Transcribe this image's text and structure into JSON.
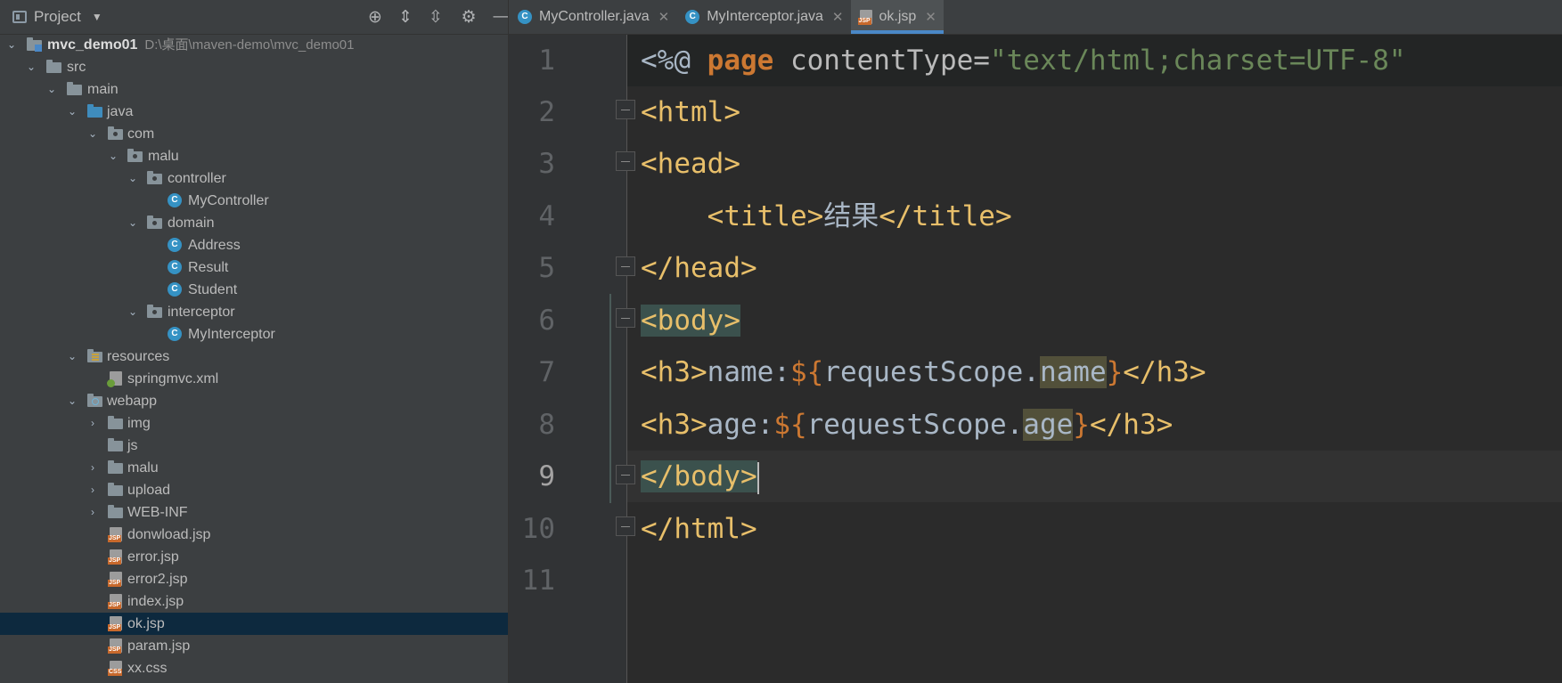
{
  "project": {
    "title": "Project",
    "tools": [
      "crosshair-icon",
      "expand-all-icon",
      "collapse-all-icon",
      "gear-icon",
      "minimize-icon"
    ],
    "root": {
      "name": "mvc_demo01",
      "path": "D:\\桌面\\maven-demo\\mvc_demo01"
    },
    "items": [
      {
        "label": "src"
      },
      {
        "label": "main"
      },
      {
        "label": "java"
      },
      {
        "label": "com"
      },
      {
        "label": "malu"
      },
      {
        "label": "controller"
      },
      {
        "label": "MyController"
      },
      {
        "label": "domain"
      },
      {
        "label": "Address"
      },
      {
        "label": "Result"
      },
      {
        "label": "Student"
      },
      {
        "label": "interceptor"
      },
      {
        "label": "MyInterceptor"
      },
      {
        "label": "resources"
      },
      {
        "label": "springmvc.xml"
      },
      {
        "label": "webapp"
      },
      {
        "label": "img"
      },
      {
        "label": "js"
      },
      {
        "label": "malu"
      },
      {
        "label": "upload"
      },
      {
        "label": "WEB-INF"
      },
      {
        "label": "donwload.jsp"
      },
      {
        "label": "error.jsp"
      },
      {
        "label": "error2.jsp"
      },
      {
        "label": "index.jsp"
      },
      {
        "label": "ok.jsp"
      },
      {
        "label": "param.jsp"
      },
      {
        "label": "xx.css"
      }
    ],
    "selected": "ok.jsp"
  },
  "tabs": [
    {
      "label": "MyController.java",
      "icon": "C"
    },
    {
      "label": "MyInterceptor.java",
      "icon": "C"
    },
    {
      "label": "ok.jsp",
      "icon": "JSP",
      "active": true
    }
  ],
  "editor": {
    "line_numbers": [
      "1",
      "2",
      "3",
      "4",
      "5",
      "6",
      "7",
      "8",
      "9",
      "10",
      "11"
    ],
    "current_line": "9",
    "code": {
      "l1": {
        "open": "<%@ ",
        "kw": "page",
        "attr": " contentType=",
        "str": "\"text/html;charset=UTF-8\""
      },
      "l2": "<html>",
      "l3": "<head>",
      "l4": {
        "indent": "    ",
        "open": "<title>",
        "text": "结果",
        "close": "</title>"
      },
      "l5": "</head>",
      "l6": "<body>",
      "l7": {
        "open": "<h3>",
        "text": "name:",
        "el_open": "${",
        "expr": "requestScope.",
        "prop": "name",
        "el_close": "}",
        "close": "</h3>"
      },
      "l8": {
        "open": "<h3>",
        "text": "age:",
        "el_open": "${",
        "expr": "requestScope.",
        "prop": "age",
        "el_close": "}",
        "close": "</h3>"
      },
      "l9": "</body>",
      "l10": "</html>"
    }
  }
}
